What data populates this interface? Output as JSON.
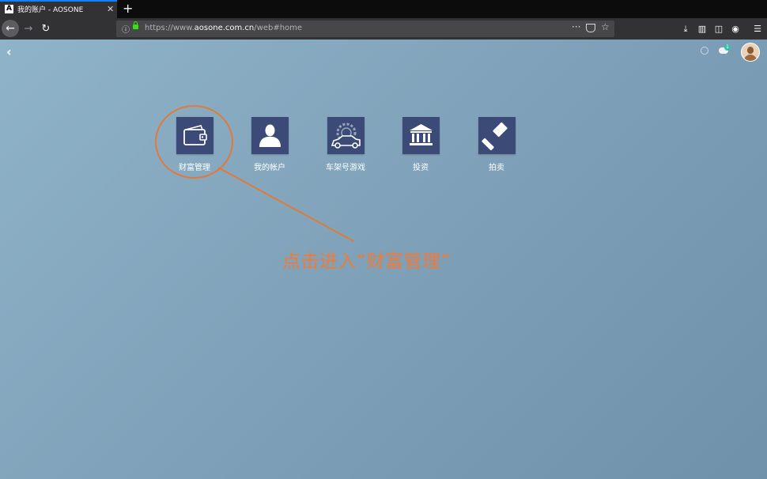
{
  "browser": {
    "tab_title": "我的账户 - AOSONE",
    "tab_favicon": "A",
    "url_prefix": "https://www.",
    "url_domain": "aosone.com.cn",
    "url_path": "/web#home"
  },
  "apps": [
    {
      "label": "财富管理",
      "icon": "wallet-icon"
    },
    {
      "label": "我的帐户",
      "icon": "user-icon"
    },
    {
      "label": "车架号游戏",
      "icon": "car-gear-icon"
    },
    {
      "label": "投资",
      "icon": "bank-icon"
    },
    {
      "label": "拍卖",
      "icon": "gavel-icon"
    }
  ],
  "annotation": {
    "text": "点击进入“财富管理”",
    "color": "#f07a38"
  },
  "header": {
    "chat_badge_count": "1"
  },
  "colors": {
    "tile": "#3b4a77",
    "background": "#7a9fb6",
    "accent": "#e07a3a"
  }
}
